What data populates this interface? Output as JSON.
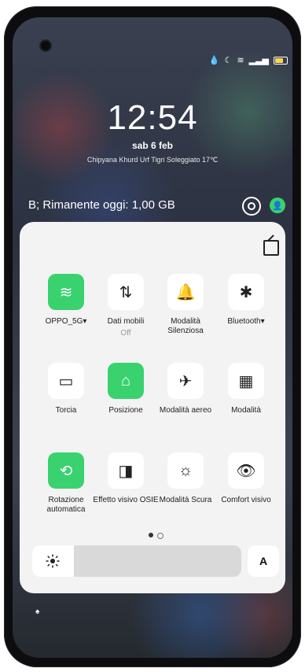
{
  "status": {
    "time": "12:54",
    "date": "sab 6 feb",
    "weather": "Chipyana Khurd Urf Tigri Soleggiato 17℃"
  },
  "data_usage": {
    "text": "B; Rimanente oggi: 1,00 GB"
  },
  "quick_settings": {
    "tiles": [
      {
        "label": "OPPO_5G▾",
        "sub": "",
        "icon": "wifi-icon",
        "active": true
      },
      {
        "label": "Dati mobili",
        "sub": "Off",
        "icon": "mobile-data-icon",
        "active": false
      },
      {
        "label": "Modalità Silenziosa",
        "sub": "",
        "icon": "bell-icon",
        "active": false
      },
      {
        "label": "Bluetooth▾",
        "sub": "",
        "icon": "bluetooth-icon",
        "active": false
      },
      {
        "label": "Torcia",
        "sub": "",
        "icon": "flashlight-icon",
        "active": false
      },
      {
        "label": "Posizione",
        "sub": "",
        "icon": "location-icon",
        "active": true
      },
      {
        "label": "Modalità aereo",
        "sub": "",
        "icon": "airplane-icon",
        "active": false
      },
      {
        "label": "Modalità",
        "sub": "",
        "icon": "grid-icon",
        "active": false
      },
      {
        "label": "Rotazione automatica",
        "sub": "",
        "icon": "rotate-icon",
        "active": true
      },
      {
        "label": "Effetto visivo OSIE",
        "sub": "",
        "icon": "split-screen-icon",
        "active": false
      },
      {
        "label": "Modalità Scura",
        "sub": "",
        "icon": "dark-mode-icon",
        "active": false
      },
      {
        "label": "Comfort visivo",
        "sub": "",
        "icon": "eye-icon",
        "active": false
      }
    ],
    "pager": {
      "current": 1,
      "total": 2
    },
    "brightness": {
      "level": 0.2,
      "auto_label": "A"
    }
  },
  "colors": {
    "accent_green": "#39d26f",
    "panel_bg": "#f3f3f3"
  }
}
